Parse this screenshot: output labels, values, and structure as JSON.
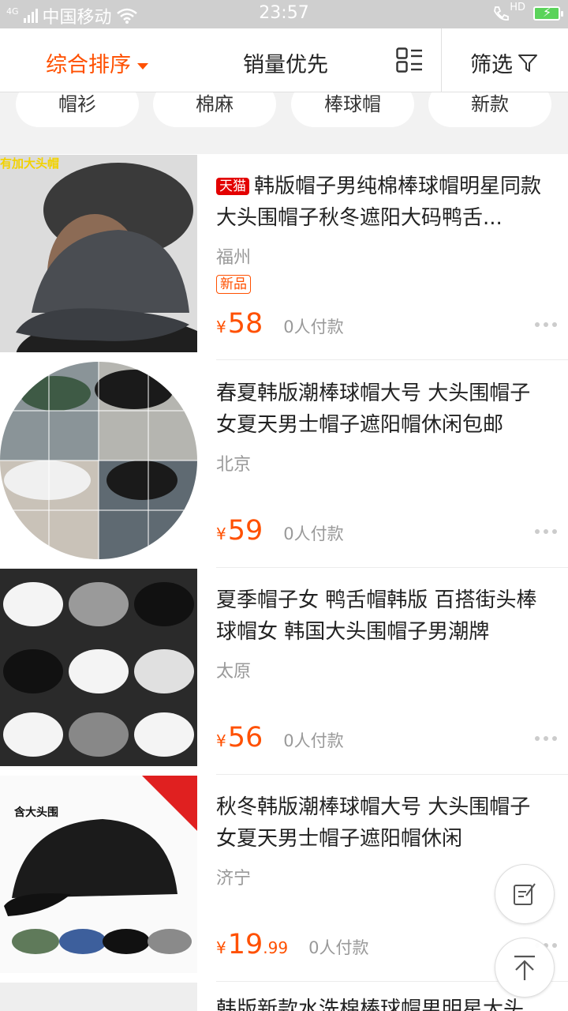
{
  "status_bar": {
    "network": "4G",
    "carrier": "中国移动",
    "time": "23:57",
    "hd": "HD"
  },
  "sort_bar": {
    "comprehensive": "综合排序",
    "sales": "销量优先",
    "filter": "筛选"
  },
  "tags": [
    "帽衫",
    "棉麻",
    "棒球帽",
    "新款"
  ],
  "products": [
    {
      "tmall": "天猫",
      "title": "韩版帽子男纯棉棒球帽明星同款大头围帽子秋冬遮阳大码鸭舌...",
      "city": "福州",
      "badge": "新品",
      "price": "58",
      "paid": "0人付款",
      "image_caption": "有加大头帽"
    },
    {
      "title": "春夏韩版潮棒球帽大号 大头围帽子女夏天男士帽子遮阳帽休闲包邮",
      "city": "北京",
      "price": "59",
      "paid": "0人付款"
    },
    {
      "title": "夏季帽子女 鸭舌帽韩版 百搭街头棒球帽女 韩国大头围帽子男潮牌",
      "city": "太原",
      "price": "56",
      "paid": "0人付款"
    },
    {
      "title": "秋冬韩版潮棒球帽大号 大头围帽子女夏天男士帽子遮阳帽休闲",
      "city": "济宁",
      "price": "19",
      "price_cents": ".99",
      "paid": "0人付款",
      "image_caption": "含大头围"
    },
    {
      "title": "韩版新款水洗棉棒球帽男明星大头"
    }
  ],
  "currency": "¥",
  "colors": {
    "accent": "#ff5000",
    "tmall_red": "#e30000",
    "page_bg": "#f2f2f2"
  }
}
